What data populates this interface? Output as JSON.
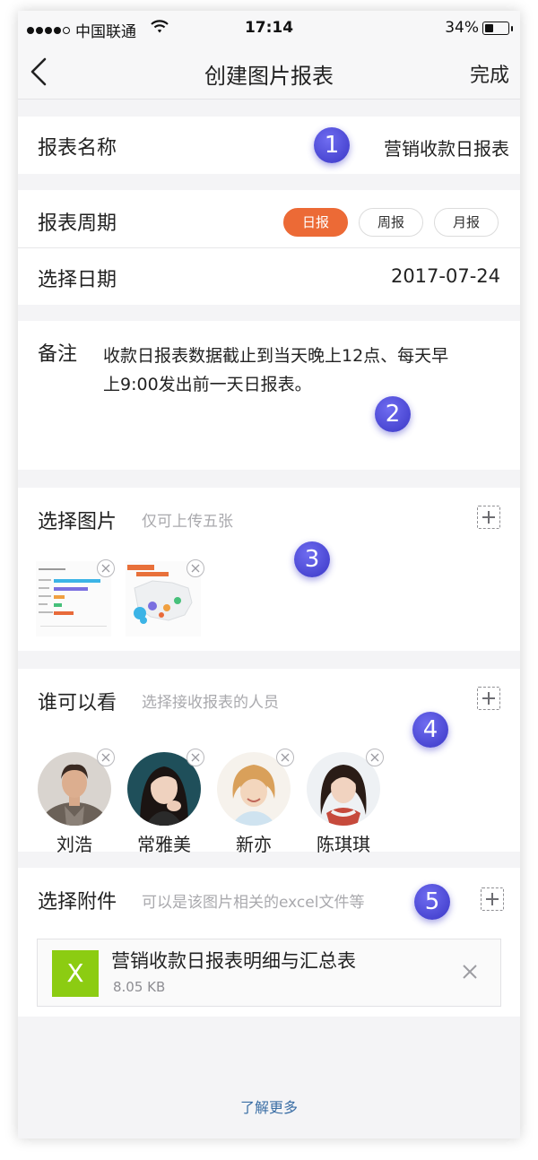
{
  "status_bar": {
    "carrier": "中国联通",
    "time": "17:14",
    "battery": "34%"
  },
  "nav": {
    "title": "创建图片报表",
    "done_label": "完成"
  },
  "report_name": {
    "label": "报表名称",
    "value": "营销收款日报表"
  },
  "report_period": {
    "label": "报表周期",
    "options": [
      "日报",
      "周报",
      "月报"
    ],
    "selected": "日报"
  },
  "select_date": {
    "label": "选择日期",
    "value": "2017-07-24"
  },
  "remark": {
    "label": "备注",
    "line1": "收款日报表数据截止到当天晚上12点、每天早",
    "line2": "上9:00发出前一天日报表。"
  },
  "images": {
    "label": "选择图片",
    "hint": "仅可上传五张"
  },
  "viewers": {
    "label": "谁可以看",
    "hint": "选择接收报表的人员",
    "people": [
      "刘浩",
      "常雅美",
      "新亦",
      "陈琪琪"
    ]
  },
  "attachments": {
    "label": "选择附件",
    "hint": "可以是该图片相关的excel文件等",
    "file": {
      "icon_letter": "X",
      "name": "营销收款日报表明细与汇总表",
      "size": "8.05 KB"
    }
  },
  "footer_link": "了解更多",
  "badges": [
    "1",
    "2",
    "3",
    "4",
    "5"
  ],
  "colors": {
    "accent": "#ec6a36",
    "badge": "#4a47d6",
    "excel": "#8ccc12",
    "link": "#3a6ea5"
  }
}
